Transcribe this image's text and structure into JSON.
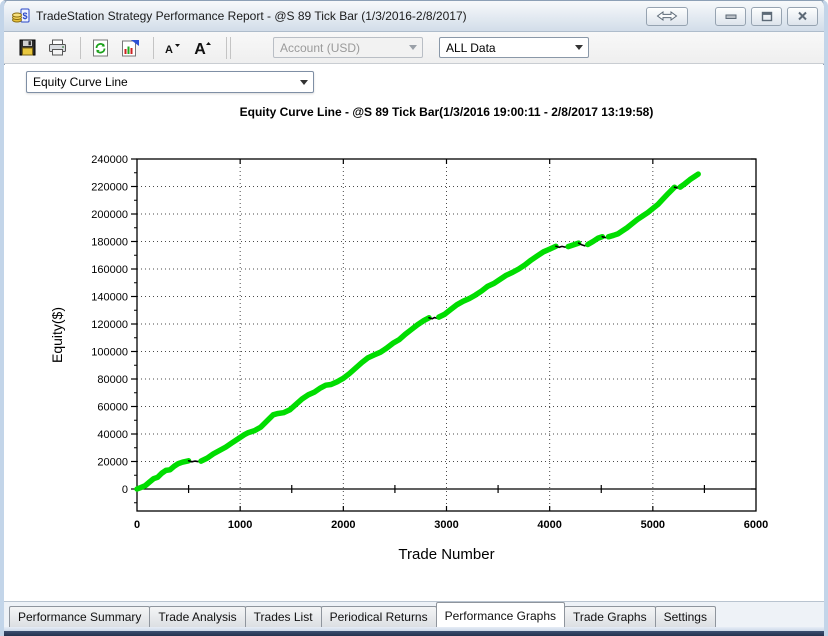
{
  "window": {
    "title": "TradeStation Strategy Performance Report - @S 89 Tick Bar (1/3/2016-2/8/2017)",
    "controls": [
      "resize-horizontal",
      "minimize",
      "restore",
      "close"
    ]
  },
  "toolbar": {
    "buttons": [
      "save",
      "print",
      "refresh",
      "format-report",
      "font-decrease",
      "font-increase"
    ],
    "account_combo": {
      "value": "Account (USD)",
      "disabled": true
    },
    "range_combo": {
      "value": "ALL Data"
    }
  },
  "graph_combo": {
    "value": "Equity Curve Line"
  },
  "chart_data": {
    "type": "line",
    "title": "Equity Curve Line - @S 89 Tick Bar(1/3/2016 19:00:11 - 2/8/2017 13:19:58)",
    "xlabel": "Trade Number",
    "ylabel": "Equity($)",
    "xlim": [
      0,
      6000
    ],
    "ylim": [
      -16000,
      240000
    ],
    "xticks": [
      0,
      1000,
      2000,
      3000,
      4000,
      5000,
      6000
    ],
    "yticks": [
      0,
      20000,
      40000,
      60000,
      80000,
      100000,
      120000,
      140000,
      160000,
      180000,
      200000,
      220000,
      240000
    ],
    "y_minor_step": 10000,
    "x_zero_line_ticks": [
      500,
      1500,
      2500,
      3500,
      4500,
      5500
    ],
    "grid": "dotted",
    "legend": "none",
    "line_colors": {
      "green": "#00dd00",
      "black": "#000000"
    },
    "segments": [
      {
        "color": "green",
        "points": [
          [
            0,
            0
          ],
          [
            40,
            1200
          ],
          [
            80,
            2500
          ],
          [
            120,
            5000
          ],
          [
            160,
            7500
          ],
          [
            200,
            8500
          ],
          [
            240,
            11500
          ],
          [
            280,
            13500
          ],
          [
            320,
            14000
          ],
          [
            360,
            16500
          ],
          [
            400,
            18500
          ],
          [
            440,
            19500
          ],
          [
            500,
            20500
          ]
        ]
      },
      {
        "color": "black",
        "points": [
          [
            500,
            20500
          ],
          [
            530,
            19800
          ],
          [
            560,
            20300
          ],
          [
            590,
            19900
          ],
          [
            620,
            20300
          ]
        ]
      },
      {
        "color": "green",
        "points": [
          [
            620,
            20300
          ],
          [
            680,
            22500
          ],
          [
            740,
            25500
          ],
          [
            800,
            28000
          ],
          [
            860,
            30500
          ],
          [
            920,
            33500
          ],
          [
            980,
            36500
          ],
          [
            1040,
            39500
          ],
          [
            1080,
            41000
          ],
          [
            1140,
            42500
          ],
          [
            1200,
            45000
          ],
          [
            1260,
            49500
          ],
          [
            1320,
            54000
          ],
          [
            1360,
            54800
          ],
          [
            1420,
            55500
          ],
          [
            1480,
            57500
          ],
          [
            1540,
            61500
          ],
          [
            1600,
            65500
          ],
          [
            1660,
            68500
          ],
          [
            1720,
            70500
          ],
          [
            1780,
            73500
          ],
          [
            1830,
            75500
          ],
          [
            1880,
            76000
          ],
          [
            1940,
            78000
          ],
          [
            2000,
            80500
          ],
          [
            2060,
            84000
          ],
          [
            2120,
            88000
          ],
          [
            2180,
            92000
          ],
          [
            2240,
            95500
          ],
          [
            2300,
            97500
          ],
          [
            2360,
            99500
          ],
          [
            2420,
            102500
          ],
          [
            2480,
            106000
          ],
          [
            2540,
            108500
          ],
          [
            2600,
            112500
          ],
          [
            2660,
            116000
          ],
          [
            2720,
            119500
          ],
          [
            2780,
            122500
          ],
          [
            2830,
            124500
          ]
        ]
      },
      {
        "color": "black",
        "points": [
          [
            2830,
            124500
          ],
          [
            2860,
            123800
          ],
          [
            2885,
            124700
          ],
          [
            2905,
            124200
          ],
          [
            2925,
            125000
          ]
        ]
      },
      {
        "color": "green",
        "points": [
          [
            2925,
            125000
          ],
          [
            2980,
            127000
          ],
          [
            3040,
            130500
          ],
          [
            3100,
            134000
          ],
          [
            3160,
            136500
          ],
          [
            3220,
            138500
          ],
          [
            3280,
            141000
          ],
          [
            3340,
            144000
          ],
          [
            3400,
            147500
          ],
          [
            3460,
            149500
          ],
          [
            3520,
            152500
          ],
          [
            3580,
            155500
          ],
          [
            3640,
            157500
          ],
          [
            3700,
            160000
          ],
          [
            3760,
            163000
          ],
          [
            3820,
            166500
          ],
          [
            3880,
            169500
          ],
          [
            3940,
            172500
          ],
          [
            4000,
            174500
          ],
          [
            4060,
            176500
          ]
        ]
      },
      {
        "color": "black",
        "points": [
          [
            4060,
            176500
          ],
          [
            4090,
            175800
          ],
          [
            4120,
            176400
          ],
          [
            4150,
            175900
          ],
          [
            4180,
            176300
          ]
        ]
      },
      {
        "color": "green",
        "points": [
          [
            4180,
            176300
          ],
          [
            4230,
            177500
          ],
          [
            4280,
            178800
          ]
        ]
      },
      {
        "color": "black",
        "points": [
          [
            4280,
            178800
          ],
          [
            4310,
            177600
          ],
          [
            4340,
            176900
          ],
          [
            4370,
            177800
          ]
        ]
      },
      {
        "color": "green",
        "points": [
          [
            4370,
            177800
          ],
          [
            4420,
            180000
          ],
          [
            4470,
            182500
          ],
          [
            4510,
            183500
          ]
        ]
      },
      {
        "color": "black",
        "points": [
          [
            4510,
            183500
          ],
          [
            4540,
            182800
          ],
          [
            4570,
            183400
          ]
        ]
      },
      {
        "color": "green",
        "points": [
          [
            4570,
            183400
          ],
          [
            4620,
            184500
          ],
          [
            4660,
            185500
          ],
          [
            4700,
            187500
          ],
          [
            4750,
            190000
          ],
          [
            4800,
            193000
          ],
          [
            4850,
            196000
          ],
          [
            4900,
            198500
          ],
          [
            4950,
            201000
          ],
          [
            5000,
            204000
          ],
          [
            5050,
            207000
          ],
          [
            5100,
            211000
          ],
          [
            5150,
            215000
          ],
          [
            5210,
            219500
          ]
        ]
      },
      {
        "color": "black",
        "points": [
          [
            5210,
            219500
          ],
          [
            5240,
            218900
          ],
          [
            5265,
            219600
          ]
        ]
      },
      {
        "color": "green",
        "points": [
          [
            5265,
            219600
          ],
          [
            5310,
            222000
          ],
          [
            5360,
            225000
          ],
          [
            5410,
            227500
          ],
          [
            5440,
            229000
          ]
        ]
      }
    ]
  },
  "tabs": {
    "items": [
      {
        "label": "Performance Summary",
        "active": false
      },
      {
        "label": "Trade Analysis",
        "active": false
      },
      {
        "label": "Trades List",
        "active": false
      },
      {
        "label": "Periodical Returns",
        "active": false
      },
      {
        "label": "Performance Graphs",
        "active": true
      },
      {
        "label": "Trade Graphs",
        "active": false
      },
      {
        "label": "Settings",
        "active": false
      }
    ]
  },
  "colors": {
    "titlebar_top": "#f7f9fb",
    "titlebar_bottom": "#d2dde9",
    "window_border": "#c3d5e9",
    "window_bottom_border": "#1f2c47",
    "curve_green": "#00dd00",
    "curve_drawdown": "#000000"
  }
}
